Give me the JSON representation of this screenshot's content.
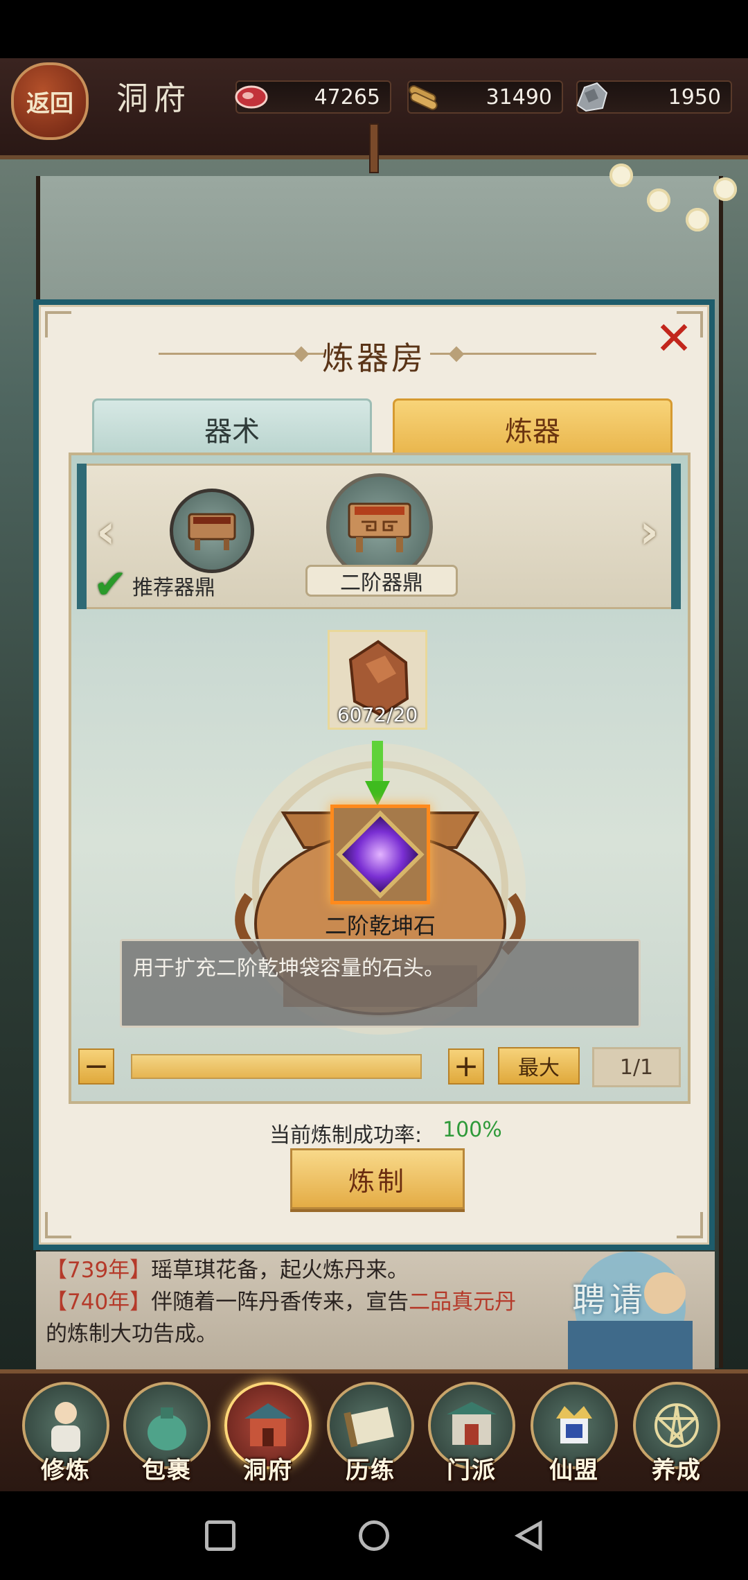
{
  "header": {
    "back_label": "返回",
    "title": "洞府",
    "resources": [
      {
        "icon": "meat-icon",
        "value": "47265"
      },
      {
        "icon": "wood-icon",
        "value": "31490"
      },
      {
        "icon": "ore-icon",
        "value": "1950"
      }
    ]
  },
  "dialog": {
    "title": "炼器房",
    "tabs": [
      {
        "label": "器术",
        "selected": false
      },
      {
        "label": "炼器",
        "selected": true
      }
    ],
    "selector": {
      "recommended_label": "推荐器鼎",
      "selected_label": "二阶器鼎"
    },
    "material": {
      "count": "6072/20"
    },
    "product": {
      "name": "二阶乾坤石",
      "description": "用于扩充二阶乾坤袋容量的石头。"
    },
    "quantity": {
      "minus": "−",
      "plus": "+",
      "max_label": "最大",
      "value": "1/1"
    },
    "success_rate": {
      "label": "当前炼制成功率:",
      "value": "100%"
    },
    "craft_label": "炼制"
  },
  "log": {
    "line1_year": "【739年】",
    "line1_text": "瑶草琪花备，起火炼丹来。",
    "line2_year": "【740年】",
    "line2_text": "伴随着一阵丹香传来，宣告",
    "line2_highlight": "二品真元丹",
    "line2_tail": "的炼制大功告成。"
  },
  "recruit_label": "聘请",
  "nav": [
    {
      "label": "修炼",
      "active": false
    },
    {
      "label": "包裹",
      "active": false
    },
    {
      "label": "洞府",
      "active": true
    },
    {
      "label": "历练",
      "active": false
    },
    {
      "label": "门派",
      "active": false
    },
    {
      "label": "仙盟",
      "active": false
    },
    {
      "label": "养成",
      "active": false
    }
  ],
  "colors": {
    "accent_gold": "#e8b44a",
    "success_green": "#2f9a3a",
    "close_red": "#c2261c",
    "log_highlight": "#b53a2a"
  }
}
